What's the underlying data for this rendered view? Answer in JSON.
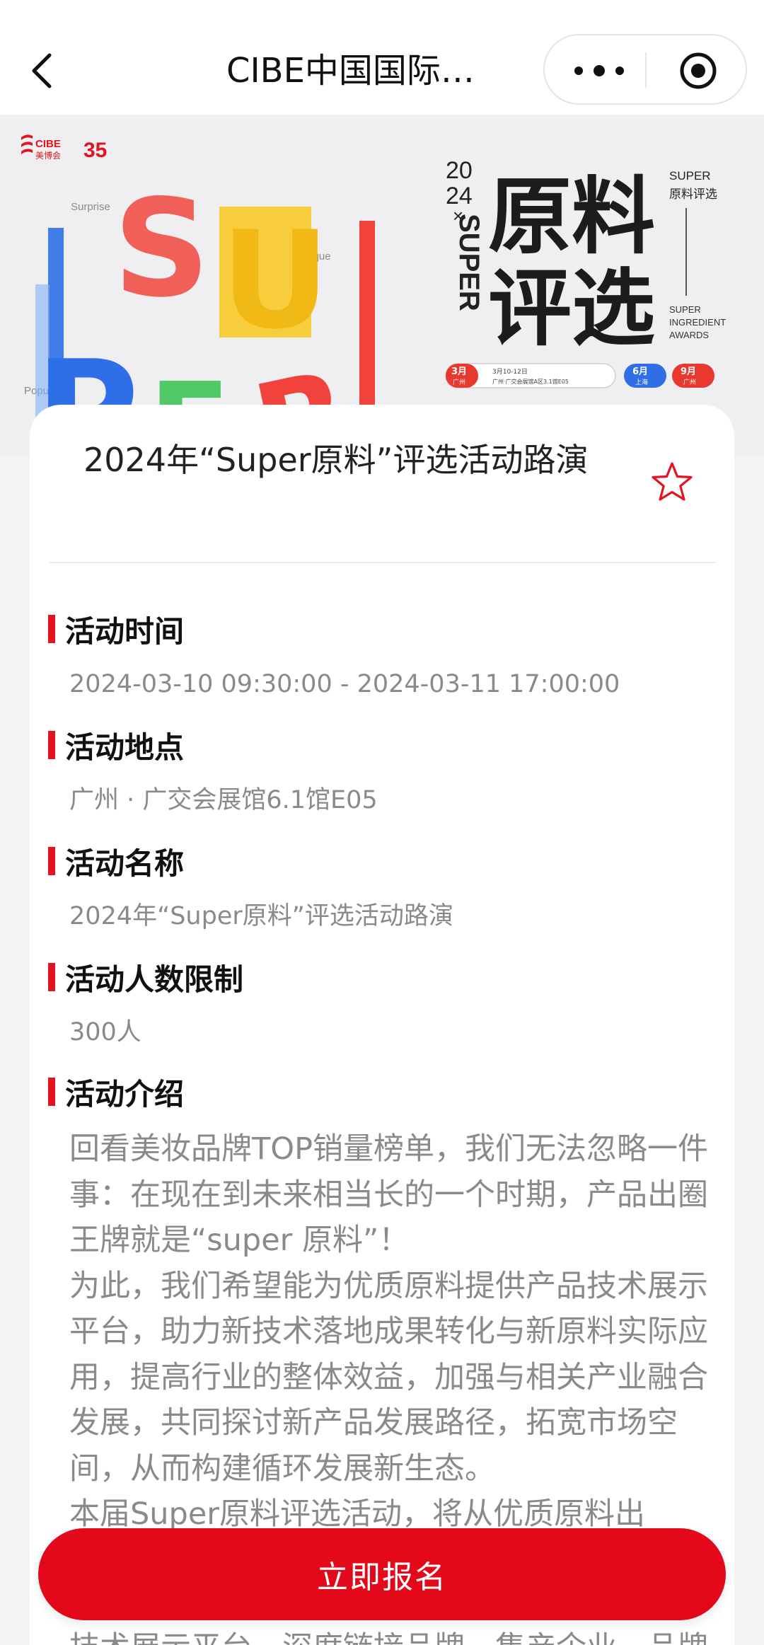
{
  "nav": {
    "title": "CIBE中国国际…"
  },
  "banner": {
    "logo_text": "CIBE 美博会",
    "anniversary": "35",
    "left_words": [
      "Surprise",
      "Unique",
      "Popular"
    ],
    "big_letters": [
      "S",
      "U",
      "P",
      "E",
      "R"
    ],
    "year_top": "20",
    "year_bottom": "24",
    "cross": "×",
    "super_vertical": "SUPER",
    "headline_line1": "原料",
    "headline_line2": "评选",
    "side_top_en": "SUPER",
    "side_top_cn": "原料评选",
    "side_bottom": [
      "SUPER",
      "INGREDIENT",
      "AWARDS"
    ],
    "badge_mar": "3月",
    "badge_mar_city": "广州",
    "schedule_line1": "3月10-12日",
    "schedule_line2": "广州·广交会展馆A区3.1馆E05",
    "badge_jun": "6月",
    "badge_jun_city": "上海",
    "badge_sep": "9月",
    "badge_sep_city": "广州",
    "colors": {
      "s": "#f2463f",
      "u": "#f7c928",
      "p": "#2e6fe8",
      "e": "#3fc456",
      "r": "#f1433c",
      "badge_red": "#e9382e",
      "badge_blue": "#2f6ee6"
    }
  },
  "event": {
    "title": "2024年“Super原料”评选活动路演",
    "sections": [
      {
        "label": "活动时间",
        "value": "2024-03-10 09:30:00 - 2024-03-11 17:00:00"
      },
      {
        "label": "活动地点",
        "value": "广州 · 广交会展馆6.1馆E05"
      },
      {
        "label": "活动名称",
        "value": "2024年“Super原料”评选活动路演"
      },
      {
        "label": "活动人数限制",
        "value": "300人"
      },
      {
        "label": "活动介绍",
        "value": ""
      }
    ],
    "intro_text": "回看美妆品牌TOP销量榜单，我们无法忽略一件事：在现在到未来相当长的一个时期，产品出圈王牌就是“super 原料”！\n为此，我们希望能为优质原料提供产品技术展示平台，助力新技术落地成果转化与新原料实际应用，提高行业的整体效益，加强与相关产业融合发展，共同探讨新产品发展路径，拓宽市场空间，从而构建循环发展新生态。\n本届Super原料评选活动，将从优质原料出",
    "peek_text": "技术展示平台、深度链接品牌、集产企业、品牌"
  },
  "cta": {
    "label": "立即报名",
    "color": "#e3091a"
  },
  "icons": {
    "back": "chevron-left-icon",
    "more": "more-dots-icon",
    "close": "target-icon",
    "favorite": "star-outline-icon"
  }
}
